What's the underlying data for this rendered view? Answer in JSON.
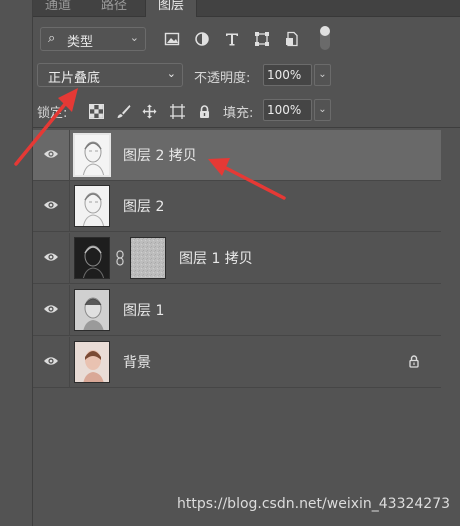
{
  "tabs": [
    {
      "label": "通道"
    },
    {
      "label": "路径"
    },
    {
      "label": "图层"
    }
  ],
  "filter": {
    "kind_label": "类型"
  },
  "blend": {
    "mode": "正片叠底"
  },
  "opacity": {
    "label": "不透明度:",
    "value": "100%"
  },
  "lock": {
    "label": "锁定:"
  },
  "fill": {
    "label": "填充:",
    "value": "100%"
  },
  "layers": [
    {
      "name": "图层 2 拷贝",
      "selected": true
    },
    {
      "name": "图层 2",
      "selected": false
    },
    {
      "name": "图层 1 拷贝",
      "selected": false,
      "has_mask": true
    },
    {
      "name": "图层 1",
      "selected": false
    },
    {
      "name": "背景",
      "selected": false,
      "locked": true
    }
  ],
  "watermark": "https://blog.csdn.net/weixin_43324273",
  "colors": {
    "panel_bg": "#535353",
    "selected_row": "#696969",
    "annotation_red": "#e53935"
  }
}
